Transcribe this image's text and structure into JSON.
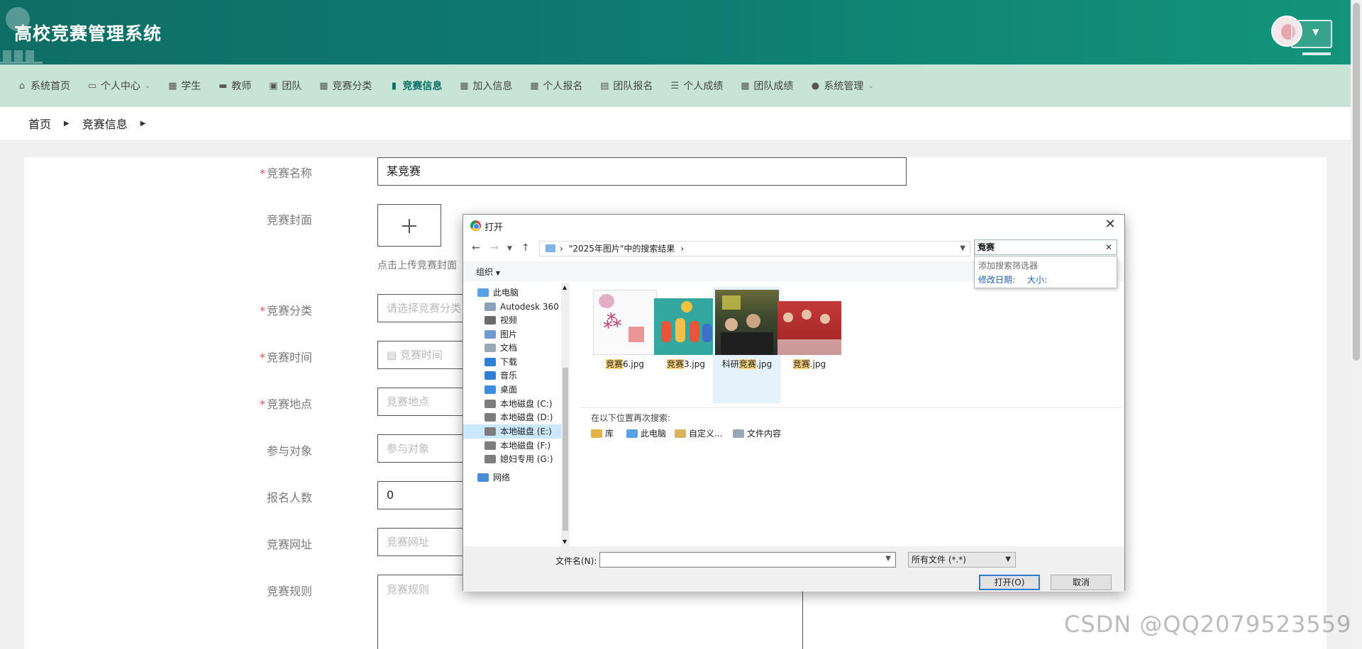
{
  "app": {
    "title": "高校竞赛管理系统"
  },
  "nav": [
    {
      "label": "系统首页",
      "icon": "home-icon",
      "glyph": "⌂",
      "dropdown": false,
      "active": false
    },
    {
      "label": "个人中心",
      "icon": "card-icon",
      "glyph": "▭",
      "dropdown": true,
      "active": false
    },
    {
      "label": "学生",
      "icon": "grid-icon",
      "glyph": "▦",
      "dropdown": false,
      "active": false
    },
    {
      "label": "教师",
      "icon": "briefcase-icon",
      "glyph": "▬",
      "dropdown": false,
      "active": false
    },
    {
      "label": "团队",
      "icon": "monitor-icon",
      "glyph": "▣",
      "dropdown": false,
      "active": false
    },
    {
      "label": "竞赛分类",
      "icon": "grid-icon",
      "glyph": "▦",
      "dropdown": false,
      "active": false
    },
    {
      "label": "竞赛信息",
      "icon": "chart-icon",
      "glyph": "▮",
      "dropdown": false,
      "active": true
    },
    {
      "label": "加入信息",
      "icon": "grid-icon",
      "glyph": "▦",
      "dropdown": false,
      "active": false
    },
    {
      "label": "个人报名",
      "icon": "grid-icon",
      "glyph": "▦",
      "dropdown": false,
      "active": false
    },
    {
      "label": "团队报名",
      "icon": "clipboard-icon",
      "glyph": "▤",
      "dropdown": false,
      "active": false
    },
    {
      "label": "个人成绩",
      "icon": "list-icon",
      "glyph": "☰",
      "dropdown": false,
      "active": false
    },
    {
      "label": "团队成绩",
      "icon": "grid-icon",
      "glyph": "▦",
      "dropdown": false,
      "active": false
    },
    {
      "label": "系统管理",
      "icon": "user-icon",
      "glyph": "●",
      "dropdown": true,
      "active": false
    }
  ],
  "breadcrumb": {
    "home": "首页",
    "current": "竞赛信息"
  },
  "form": {
    "name": {
      "label": "竞赛名称",
      "required": true,
      "value": "某竞赛"
    },
    "cover": {
      "label": "竞赛封面",
      "hint": "点击上传竞赛封面"
    },
    "category": {
      "label": "竞赛分类",
      "required": true,
      "placeholder": "请选择竞赛分类"
    },
    "time": {
      "label": "竞赛时间",
      "required": true,
      "placeholder": "竞赛时间"
    },
    "place": {
      "label": "竞赛地点",
      "required": true,
      "placeholder": "竞赛地点"
    },
    "target": {
      "label": "参与对象",
      "required": false,
      "placeholder": "参与对象"
    },
    "count": {
      "label": "报名人数",
      "required": false,
      "value": "0"
    },
    "url": {
      "label": "竞赛网址",
      "required": false,
      "placeholder": "竞赛网址"
    },
    "rules": {
      "label": "竞赛规则",
      "required": false,
      "placeholder": "竞赛规则"
    }
  },
  "dialog": {
    "title": "打开",
    "path": "\"2025年图片\"中的搜索结果",
    "search_value": "竞赛",
    "search_popup": {
      "heading": "添加搜索筛选器",
      "filter_date": "修改日期:",
      "filter_size": "大小:"
    },
    "organize": "组织",
    "tree": [
      {
        "label": "此电脑",
        "icon": "computer-icon",
        "color": "#5aa0e6"
      },
      {
        "label": "Autodesk 360",
        "icon": "cloud-icon",
        "color": "#8aa3b8"
      },
      {
        "label": "视频",
        "icon": "video-icon",
        "color": "#6b6b6b"
      },
      {
        "label": "图片",
        "icon": "image-icon",
        "color": "#6f9ad0"
      },
      {
        "label": "文档",
        "icon": "document-icon",
        "color": "#9aa8b6"
      },
      {
        "label": "下载",
        "icon": "download-icon",
        "color": "#2f7fd6"
      },
      {
        "label": "音乐",
        "icon": "music-icon",
        "color": "#2f7fd6"
      },
      {
        "label": "桌面",
        "icon": "desktop-icon",
        "color": "#3d8ee0"
      },
      {
        "label": "本地磁盘 (C:)",
        "icon": "drive-icon",
        "color": "#7d7d7d"
      },
      {
        "label": "本地磁盘 (D:)",
        "icon": "drive-icon",
        "color": "#7d7d7d"
      },
      {
        "label": "本地磁盘 (E:)",
        "icon": "drive-icon",
        "color": "#7d7d7d",
        "selected": true
      },
      {
        "label": "本地磁盘 (F:)",
        "icon": "drive-icon",
        "color": "#7d7d7d"
      },
      {
        "label": "媳妇专用 (G:)",
        "icon": "drive-icon",
        "color": "#7d7d7d"
      },
      {
        "label": "网络",
        "icon": "network-icon",
        "color": "#4a8bd6"
      }
    ],
    "files": [
      {
        "prefix": "",
        "hl": "竞赛",
        "suffix": "6.jpg",
        "kind": "calligraphy"
      },
      {
        "prefix": "",
        "hl": "竞赛",
        "suffix": "3.jpg",
        "kind": "cartoon"
      },
      {
        "prefix": "科研",
        "hl": "竞赛",
        "suffix": ".jpg",
        "kind": "photo-crowd",
        "selected": true
      },
      {
        "prefix": "",
        "hl": "竞赛",
        "suffix": ".jpg",
        "kind": "photo-red"
      }
    ],
    "search_again": {
      "label": "在以下位置再次搜索:",
      "items": [
        {
          "label": "库",
          "icon": "library-icon",
          "color": "#e3b345"
        },
        {
          "label": "此电脑",
          "icon": "computer-icon",
          "color": "#5aa0e6"
        },
        {
          "label": "自定义...",
          "icon": "folder-icon",
          "color": "#d9b45a"
        },
        {
          "label": "文件内容",
          "icon": "file-icon",
          "color": "#9aa8b6"
        }
      ]
    },
    "filename_label": "文件名(N):",
    "filename_value": "",
    "filetype": "所有文件 (*.*)",
    "open_button": "打开(O)",
    "cancel_button": "取消"
  },
  "watermark": "CSDN @QQ2079523559"
}
